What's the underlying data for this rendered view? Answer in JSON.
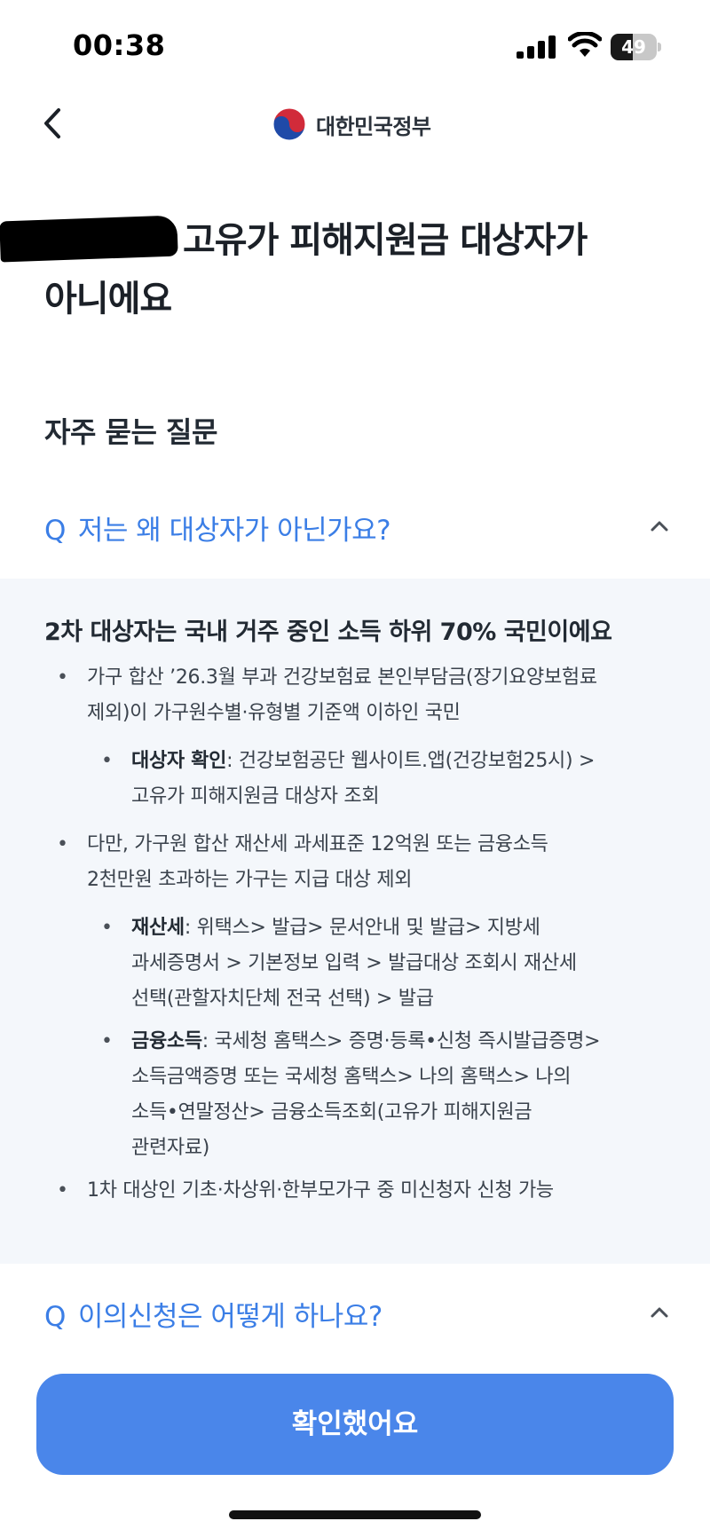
{
  "status_bar": {
    "time": "00:38",
    "battery": "49",
    "battery_level": 0.49,
    "icons": [
      "signal-icon",
      "wifi-icon",
      "battery-icon"
    ]
  },
  "nav": {
    "back_icon": "chevron-left-icon",
    "logo_text": "대한민국정부",
    "logo_icon": "taegeuk-emblem"
  },
  "headline": {
    "line1_visible": "고유가 피해지원금 대상자가",
    "line2": "아니에요"
  },
  "faq": {
    "section_title": "자주 묻는 질문",
    "questions": [
      {
        "prefix": "Q",
        "text": "저는 왜 대상자가 아닌가요?",
        "expanded": true
      },
      {
        "prefix": "Q",
        "text": "이의신청은 어떻게 하나요?",
        "expanded": false
      }
    ],
    "answer": {
      "title": "2차 대상자는 국내 거주 중인 소득 하위 70% 국민이에요",
      "items": [
        {
          "lines": [
            "가구 합산 ’26.3월 부과 건강보험료 본인부담금(장기요양보험료",
            "제외)이 가구원수별·유형별 기준액 이하인 국민"
          ]
        },
        {
          "term": "대상자 확인",
          "lines": [
            ": 건강보험공단 웹사이트.앱(건강보험25시) >",
            "고유가 피해지원금 대상자 조회"
          ]
        },
        {
          "lines": [
            "다만, 가구원 합산 재산세 과세표준 12억원 또는 금융소득",
            "2천만원 초과하는 가구는 지급 대상 제외"
          ]
        },
        {
          "term": "재산세",
          "lines": [
            ": 위택스> 발급> 문서안내 및 발급> 지방세",
            "과세증명서 > 기본정보 입력 > 발급대상 조회시 재산세",
            "선택(관할자치단체 전국 선택) > 발급"
          ]
        },
        {
          "term": "금융소득",
          "lines": [
            ": 국세청 홈택스> 증명·등록•신청 즉시발급증명>",
            "소득금액증명 또는 국세청 홈택스> 나의 홈택스> 나의",
            "소득•연말정산> 금융소득조회(고유가 피해지원금",
            "관련자료)"
          ]
        },
        {
          "lines": [
            "1차 대상인 기초·차상위·한부모가구 중 미신청자 신청 가능"
          ]
        }
      ]
    }
  },
  "confirm_button": "확인했어요",
  "colors": {
    "accent": "#3b7ee6",
    "button": "#4a86ea",
    "panel_bg": "#f4f7fb",
    "text_dark": "#1b2027"
  }
}
